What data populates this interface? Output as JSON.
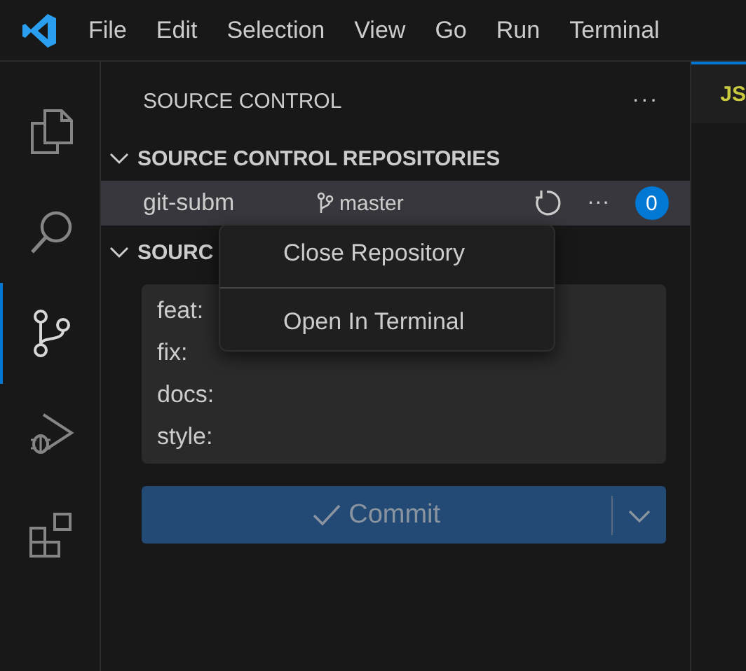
{
  "menu_bar": {
    "items": [
      "File",
      "Edit",
      "Selection",
      "View",
      "Go",
      "Run",
      "Terminal"
    ]
  },
  "activity_bar": {
    "items": [
      {
        "kind": "files",
        "selected": false
      },
      {
        "kind": "search",
        "selected": false
      },
      {
        "kind": "scm",
        "selected": true
      },
      {
        "kind": "debug",
        "selected": false
      },
      {
        "kind": "extensions",
        "selected": false
      }
    ]
  },
  "sidebar": {
    "title": "SOURCE CONTROL",
    "more": "···",
    "sections": [
      {
        "title": "SOURCE CONTROL REPOSITORIES",
        "expanded": true
      },
      {
        "title": "SOURC",
        "expanded": true
      }
    ],
    "repositories": [
      {
        "name": "git-subm",
        "branch": "master",
        "more": "···",
        "badge": "0",
        "selected": true
      }
    ],
    "commit_message": {
      "lines": [
        "feat:",
        "fix:",
        "docs:",
        "style:"
      ]
    },
    "commit_button": {
      "label": "Commit",
      "disabled": true
    }
  },
  "editor_tab": {
    "label": "JS"
  },
  "context_menu": {
    "items": [
      "Close Repository",
      "Open In Terminal"
    ]
  }
}
